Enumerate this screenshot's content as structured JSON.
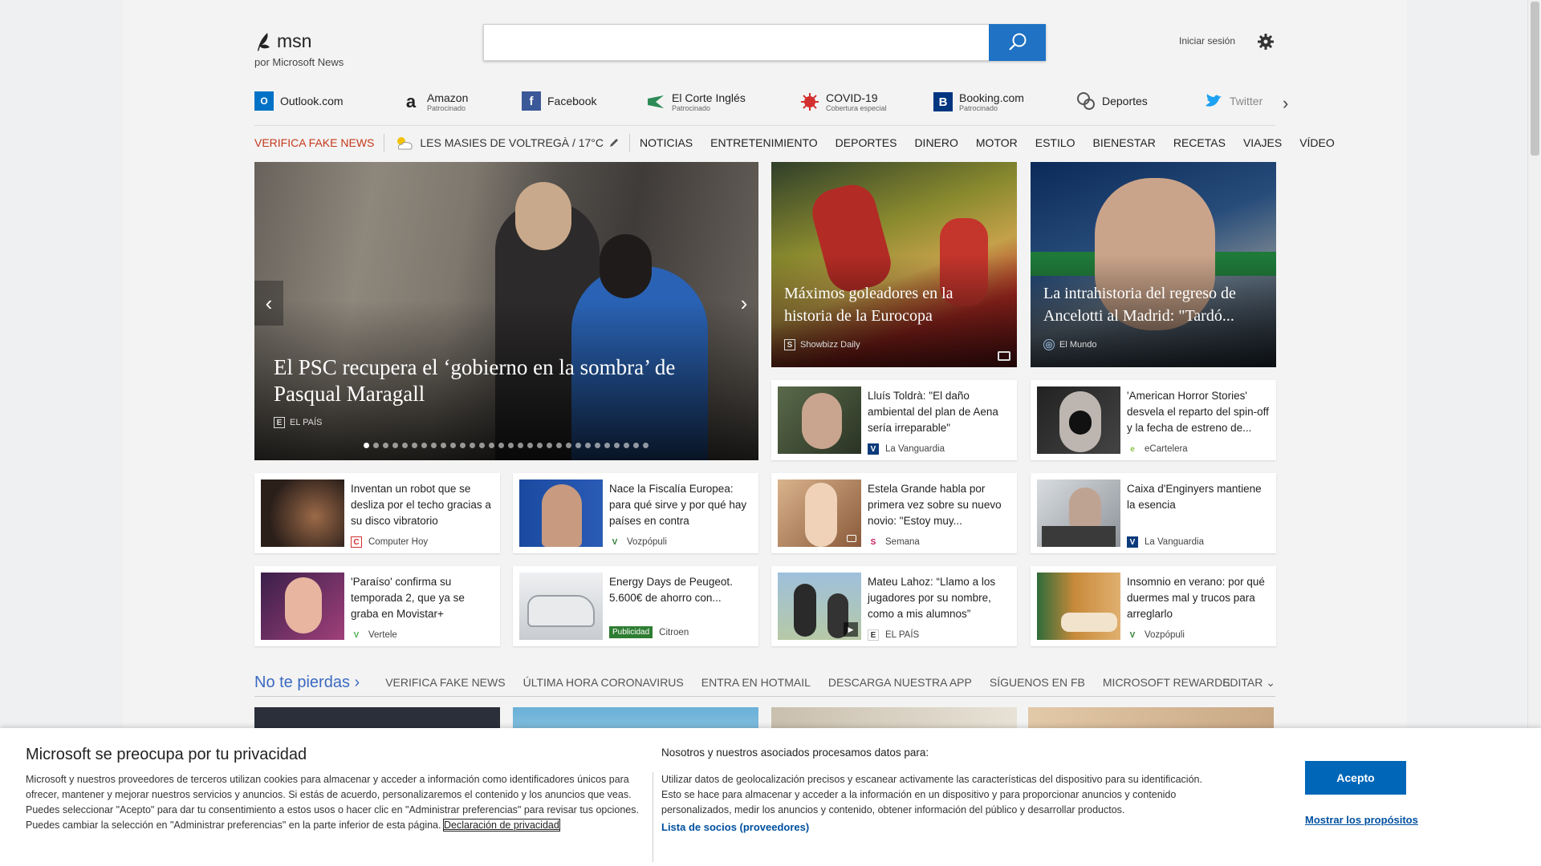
{
  "header": {
    "logo_text": "msn",
    "logo_sub": "por Microsoft News",
    "search_value": "",
    "signin": "Iniciar sesión"
  },
  "quicklinks": [
    {
      "title": "Outlook.com",
      "sub": "",
      "icon": "outlook-icon",
      "color": "#0072c6"
    },
    {
      "title": "Amazon",
      "sub": "Patrocinado",
      "icon": "amazon-icon",
      "color": "#222222"
    },
    {
      "title": "Facebook",
      "sub": "",
      "icon": "facebook-icon",
      "color": "#3b5998"
    },
    {
      "title": "El Corte Inglés",
      "sub": "Patrocinado",
      "icon": "elcorteingles-icon",
      "color": "#2e8b57"
    },
    {
      "title": "COVID-19",
      "sub": "Cobertura especial",
      "icon": "covid-icon",
      "color": "#d32f2f"
    },
    {
      "title": "Booking.com",
      "sub": "Patrocinado",
      "icon": "booking-icon",
      "color": "#003580"
    },
    {
      "title": "Deportes",
      "sub": "",
      "icon": "sports-icon",
      "color": "#555555"
    },
    {
      "title": "Twitter",
      "sub": "",
      "icon": "twitter-icon",
      "color": "#1da1f2"
    }
  ],
  "nav": {
    "fake_news": "VERIFICA FAKE NEWS",
    "weather": "LES MASIES DE VOLTREGÀ / 17°C",
    "items": [
      "NOTICIAS",
      "ENTRETENIMIENTO",
      "DEPORTES",
      "DINERO",
      "MOTOR",
      "ESTILO",
      "BIENESTAR",
      "RECETAS",
      "VIAJES",
      "VÍDEO"
    ]
  },
  "hero": {
    "title": "El PSC recupera el ‘gobierno en la sombra’ de Pasqual Maragall",
    "source": "EL PAÍS",
    "slides": 30
  },
  "bigtiles": [
    {
      "title": "Máximos goleadores en la historia de la Eurocopa",
      "source": "Showbizz Daily"
    },
    {
      "title": "La intrahistoria del regreso de Ancelotti al Madrid: \"Tardó...",
      "source": "El Mundo"
    }
  ],
  "tiles": [
    {
      "title": "Lluís Toldrà: \"El daño ambiental del plan de Aena sería irreparable\"",
      "source": "La Vanguardia",
      "src_icon": "V"
    },
    {
      "title": "'American Horror Stories' desvela el reparto del spin-off y la fecha de estreno de...",
      "source": "eCartelera",
      "src_icon": "e"
    },
    {
      "title": "Inventan un robot que se desliza por el techo gracias a su disco vibratorio",
      "source": "Computer Hoy",
      "src_icon": "C"
    },
    {
      "title": "Nace la Fiscalía Europea: para qué sirve y por qué hay países en contra",
      "source": "Vozpópuli",
      "src_icon": "V"
    },
    {
      "title": "Estela Grande habla por primera vez sobre su nuevo novio: \"Estoy muy...",
      "source": "Semana",
      "src_icon": "S"
    },
    {
      "title": "Caixa d'Enginyers mantiene la esencia",
      "source": "La Vanguardia",
      "src_icon": "V"
    },
    {
      "title": "'Paraíso' confirma su temporada 2, que ya se graba en Movistar+",
      "source": "Vertele",
      "src_icon": "V"
    },
    {
      "title": "Energy Days de Peugeot. 5.600€ de ahorro con...",
      "source": "Citroen",
      "ad": "Publicidad"
    },
    {
      "title": "Mateu Lahoz: “Llamo a los jugadores por su nombre, como a mis alumnos”",
      "source": "EL PAÍS",
      "src_icon": "E"
    },
    {
      "title": "Insomnio en verano: por qué duermes mal y trucos para arreglarlo",
      "source": "Vozpópuli",
      "src_icon": "V"
    }
  ],
  "ntp": {
    "head": "No te pierdas",
    "links": [
      "VERIFICA FAKE NEWS",
      "ÚLTIMA HORA CORONAVIRUS",
      "ENTRA EN HOTMAIL",
      "DESCARGA NUESTRA APP",
      "SÍGUENOS EN FB",
      "MICROSOFT REWARDS"
    ],
    "edit": "EDITAR"
  },
  "privacy": {
    "title": "Microsoft se preocupa por tu privacidad",
    "text": "Microsoft y nuestros proveedores de terceros utilizan cookies para almacenar y acceder a información como identificadores únicos para ofrecer, mantener y mejorar nuestros servicios y anuncios. Si estás de acuerdo, personalizaremos el contenido y los anuncios que veas. Puedes seleccionar \"Acepto\" para dar tu consentimiento a estos usos o hacer clic en \"Administrar preferencias\" para revisar tus opciones. Puedes cambiar la selección en \"Administrar preferencias\" en la parte inferior de esta página.",
    "link": "Declaración de privacidad",
    "right_title": "Nosotros y nuestros asociados procesamos datos para:",
    "right_text": "Utilizar datos de geolocalización precisos y escanear activamente las características del dispositivo para su identificación. Esto se hace para almacenar y acceder a la información en un dispositivo y para proporcionar anuncios y contenido personalizados, medir los anuncios y contenido, obtener información del público y desarrollar productos.",
    "partners": "Lista de socios (proveedores)",
    "accept": "Acepto",
    "show": "Mostrar los propósitos"
  },
  "colors": {
    "accent": "#1f72c4",
    "fake_news": "#c4391b",
    "ntp_head": "#3b6ac1",
    "accept_button": "#0067b8"
  }
}
